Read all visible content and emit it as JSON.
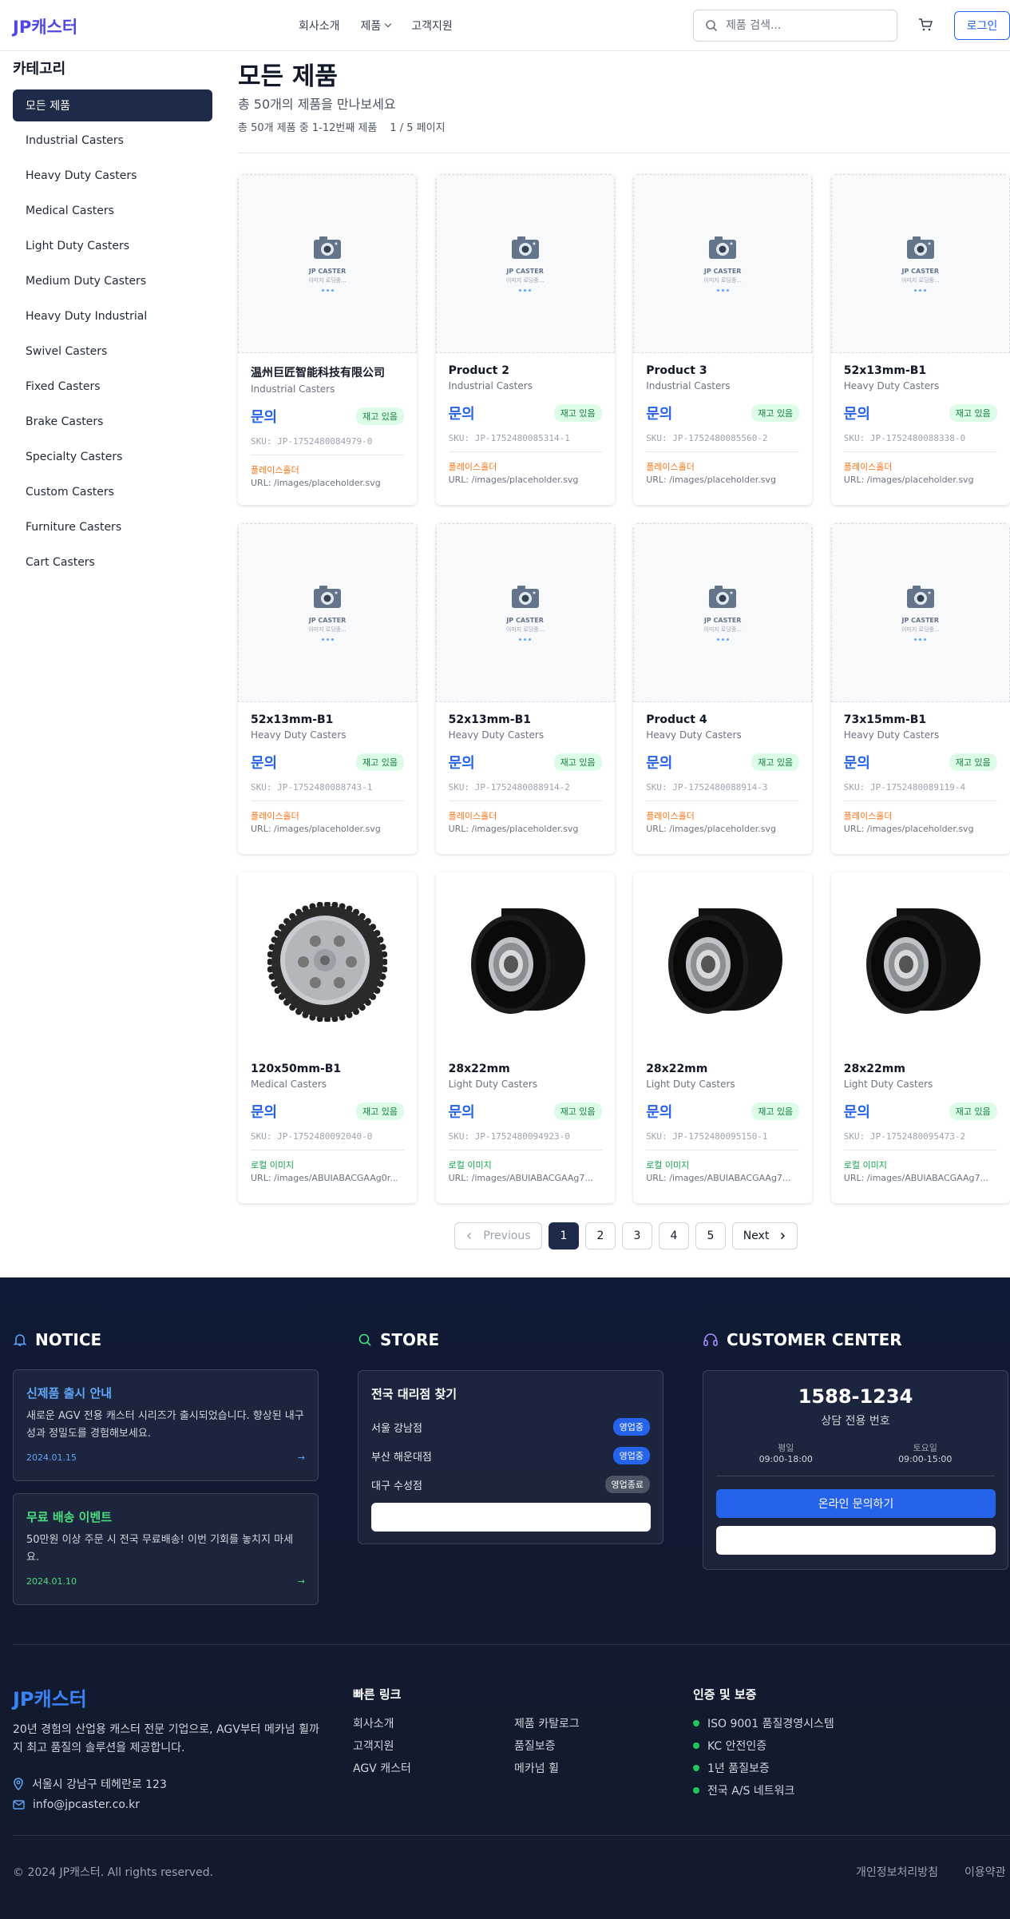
{
  "header": {
    "logo": "JP캐스터",
    "nav": [
      "회사소개",
      "제품",
      "고객지원"
    ],
    "search_placeholder": "제품 검색...",
    "login_label": "로그인"
  },
  "sidebar": {
    "title": "카테고리",
    "items": [
      {
        "label": "모든 제품",
        "active": true
      },
      {
        "label": "Industrial Casters"
      },
      {
        "label": "Heavy Duty Casters"
      },
      {
        "label": "Medical Casters"
      },
      {
        "label": "Light Duty Casters"
      },
      {
        "label": "Medium Duty Casters"
      },
      {
        "label": "Heavy Duty Industrial"
      },
      {
        "label": "Swivel Casters"
      },
      {
        "label": "Fixed Casters"
      },
      {
        "label": "Brake Casters"
      },
      {
        "label": "Specialty Casters"
      },
      {
        "label": "Custom Casters"
      },
      {
        "label": "Furniture Casters"
      },
      {
        "label": "Cart Casters"
      }
    ]
  },
  "main": {
    "title": "모든 제품",
    "subtitle": "총 50개의 제품을 만나보세요",
    "count_text": "총 50개 제품 중 1-12번째 제품",
    "page_text": "1 / 5 페이지"
  },
  "placeholder": {
    "line1": "JP CASTER",
    "line2": "이미지 로딩중..."
  },
  "products": [
    {
      "name": "温州巨匠智能科技有限公司",
      "category": "Industrial Casters",
      "price": "문의",
      "stock": "재고 있음",
      "sku": "SKU: JP-1752480084979-0",
      "source": "플레이스홀더",
      "url": "URL: /images/placeholder.svg",
      "image": "placeholder"
    },
    {
      "name": "Product 2",
      "category": "Industrial Casters",
      "price": "문의",
      "stock": "재고 있음",
      "sku": "SKU: JP-1752480085314-1",
      "source": "플레이스홀더",
      "url": "URL: /images/placeholder.svg",
      "image": "placeholder"
    },
    {
      "name": "Product 3",
      "category": "Industrial Casters",
      "price": "문의",
      "stock": "재고 있음",
      "sku": "SKU: JP-1752480085560-2",
      "source": "플레이스홀더",
      "url": "URL: /images/placeholder.svg",
      "image": "placeholder"
    },
    {
      "name": "52x13mm-B1",
      "category": "Heavy Duty Casters",
      "price": "문의",
      "stock": "재고 있음",
      "sku": "SKU: JP-1752480088338-0",
      "source": "플레이스홀더",
      "url": "URL: /images/placeholder.svg",
      "image": "placeholder"
    },
    {
      "name": "52x13mm-B1",
      "category": "Heavy Duty Casters",
      "price": "문의",
      "stock": "재고 있음",
      "sku": "SKU: JP-1752480088743-1",
      "source": "플레이스홀더",
      "url": "URL: /images/placeholder.svg",
      "image": "placeholder"
    },
    {
      "name": "52x13mm-B1",
      "category": "Heavy Duty Casters",
      "price": "문의",
      "stock": "재고 있음",
      "sku": "SKU: JP-1752480088914-2",
      "source": "플레이스홀더",
      "url": "URL: /images/placeholder.svg",
      "image": "placeholder"
    },
    {
      "name": "Product 4",
      "category": "Heavy Duty Casters",
      "price": "문의",
      "stock": "재고 있음",
      "sku": "SKU: JP-1752480088914-3",
      "source": "플레이스홀더",
      "url": "URL: /images/placeholder.svg",
      "image": "placeholder"
    },
    {
      "name": "73x15mm-B1",
      "category": "Heavy Duty Casters",
      "price": "문의",
      "stock": "재고 있음",
      "sku": "SKU: JP-1752480089119-4",
      "source": "플레이스홀더",
      "url": "URL: /images/placeholder.svg",
      "image": "placeholder"
    },
    {
      "name": "120x50mm-B1",
      "category": "Medical Casters",
      "price": "문의",
      "stock": "재고 있음",
      "sku": "SKU: JP-1752480092040-0",
      "source": "로컬 이미지",
      "url": "URL: /images/ABUIABACGAAg0r...",
      "image": "grey-wheel"
    },
    {
      "name": "28x22mm",
      "category": "Light Duty Casters",
      "price": "문의",
      "stock": "재고 있음",
      "sku": "SKU: JP-1752480094923-0",
      "source": "로컬 이미지",
      "url": "URL: /images/ABUIABACGAAg7...",
      "image": "black-roller"
    },
    {
      "name": "28x22mm",
      "category": "Light Duty Casters",
      "price": "문의",
      "stock": "재고 있음",
      "sku": "SKU: JP-1752480095150-1",
      "source": "로컬 이미지",
      "url": "URL: /images/ABUIABACGAAg7...",
      "image": "black-roller"
    },
    {
      "name": "28x22mm",
      "category": "Light Duty Casters",
      "price": "문의",
      "stock": "재고 있음",
      "sku": "SKU: JP-1752480095473-2",
      "source": "로컬 이미지",
      "url": "URL: /images/ABUIABACGAAg7...",
      "image": "black-roller"
    }
  ],
  "pagination": {
    "previous": "Previous",
    "pages": [
      "1",
      "2",
      "3",
      "4",
      "5"
    ],
    "current": "1",
    "next": "Next"
  },
  "footer": {
    "notice": {
      "heading": "NOTICE",
      "items": [
        {
          "title": "신제품 출시 안내",
          "body": "새로운 AGV 전용 캐스터 시리즈가 출시되었습니다. 향상된 내구성과 정밀도를 경험해보세요.",
          "date": "2024.01.15"
        },
        {
          "title": "무료 배송 이벤트",
          "body": "50만원 이상 주문 시 전국 무료배송! 이번 기회를 놓치지 마세요.",
          "date": "2024.01.10"
        }
      ]
    },
    "store": {
      "heading": "STORE",
      "title": "전국 대리점 찾기",
      "stores": [
        {
          "name": "서울 강남점",
          "status": "영업중",
          "open": true
        },
        {
          "name": "부산 해운대점",
          "status": "영업중",
          "open": true
        },
        {
          "name": "대구 수성점",
          "status": "영업종료",
          "open": false
        }
      ]
    },
    "customer": {
      "heading": "CUSTOMER CENTER",
      "phone": "1588-1234",
      "phone_label": "상담 전용 번호",
      "weekday_label": "평일",
      "weekday_hours": "09:00-18:00",
      "saturday_label": "토요일",
      "saturday_hours": "09:00-15:00",
      "inquiry_button": "온라인 문의하기"
    },
    "brand": {
      "logo": "JP캐스터",
      "desc": "20년 경험의 산업용 캐스터 전문 기업으로, AGV부터 메카넘 휠까지 최고 품질의 솔루션을 제공합니다.",
      "address": "서울시 강남구 테헤란로 123",
      "email": "info@jpcaster.co.kr"
    },
    "quick_links": {
      "title": "빠른 링크",
      "col1": [
        "회사소개",
        "고객지원",
        "AGV 캐스터"
      ],
      "col2": [
        "제품 카탈로그",
        "품질보증",
        "메카넘 휠"
      ]
    },
    "certs": {
      "title": "인증 및 보증",
      "items": [
        "ISO 9001 품질경영시스템",
        "KC 안전인증",
        "1년 품질보증",
        "전국 A/S 네트워크"
      ]
    },
    "copyright": "© 2024 JP캐스터. All rights reserved.",
    "legal": [
      "개인정보처리방침",
      "이용약관"
    ]
  }
}
